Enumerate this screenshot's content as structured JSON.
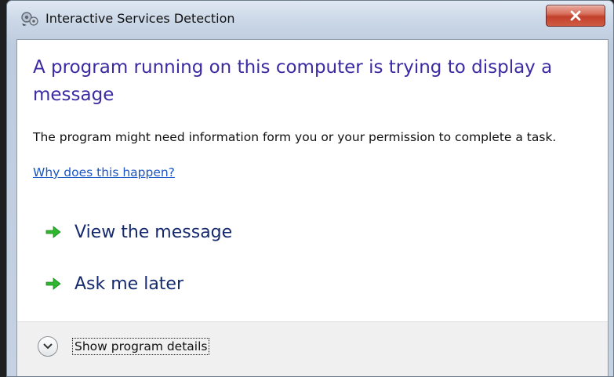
{
  "window": {
    "title": "Interactive Services Detection",
    "close_label": "x"
  },
  "content": {
    "heading": "A program running on this computer is trying to display a message",
    "description": "The program might need information form you or your permission to complete a task.",
    "why_link": "Why does this happen?"
  },
  "commands": [
    {
      "label": "View the message",
      "icon": "green-arrow-icon"
    },
    {
      "label": "Ask me later",
      "icon": "green-arrow-icon"
    }
  ],
  "footer": {
    "details_label": "Show program details",
    "icon": "chevron-down-icon"
  },
  "colors": {
    "heading": "#3b2aa3",
    "link": "#1c56c4",
    "command_text": "#152a6e",
    "arrow": "#2fb52f",
    "close_button": "#c2402b"
  }
}
